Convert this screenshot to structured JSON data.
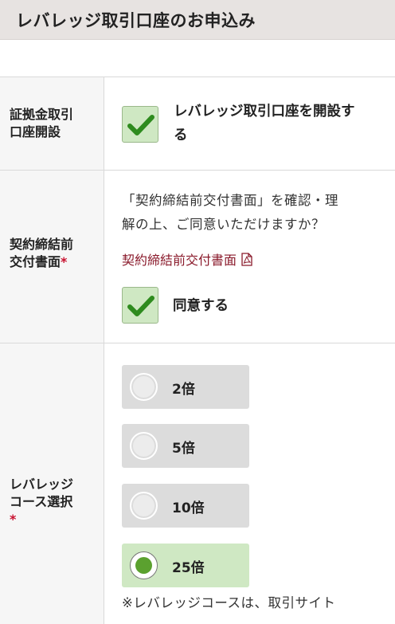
{
  "header": {
    "title": "レバレッジ取引口座のお申込み"
  },
  "rows": {
    "account": {
      "label_line1": "証拠金取引",
      "label_line2": "口座開設",
      "checkbox_checked": true,
      "text_line1": "レバレッジ取引口座を開設す",
      "text_line2": "る"
    },
    "contract": {
      "label_line1": "契約締結前",
      "label_line2": "交付書面",
      "required_mark": "*",
      "question_line1": "「契約締結前交付書面」を確認・理",
      "question_line2": "解の上、ご同意いただけますか？",
      "link_text": "契約締結前交付書面",
      "link_icon": "pdf-icon",
      "checkbox_checked": true,
      "agree_label": "同意する"
    },
    "leverage": {
      "label_line1": "レバレッジ",
      "label_line2": "コース選択",
      "required_mark": "*",
      "options": [
        {
          "label": "2倍",
          "selected": false
        },
        {
          "label": "5倍",
          "selected": false
        },
        {
          "label": "10倍",
          "selected": false
        },
        {
          "label": "25倍",
          "selected": true
        }
      ],
      "note": "※レバレッジコースは、取引サイト"
    }
  },
  "colors": {
    "accent_green": "#5ba12f",
    "checkbox_bg": "#cfe8c3",
    "required_red": "#c8102e",
    "link": "#8a1a2b",
    "header_bg": "#e7e3e1"
  }
}
